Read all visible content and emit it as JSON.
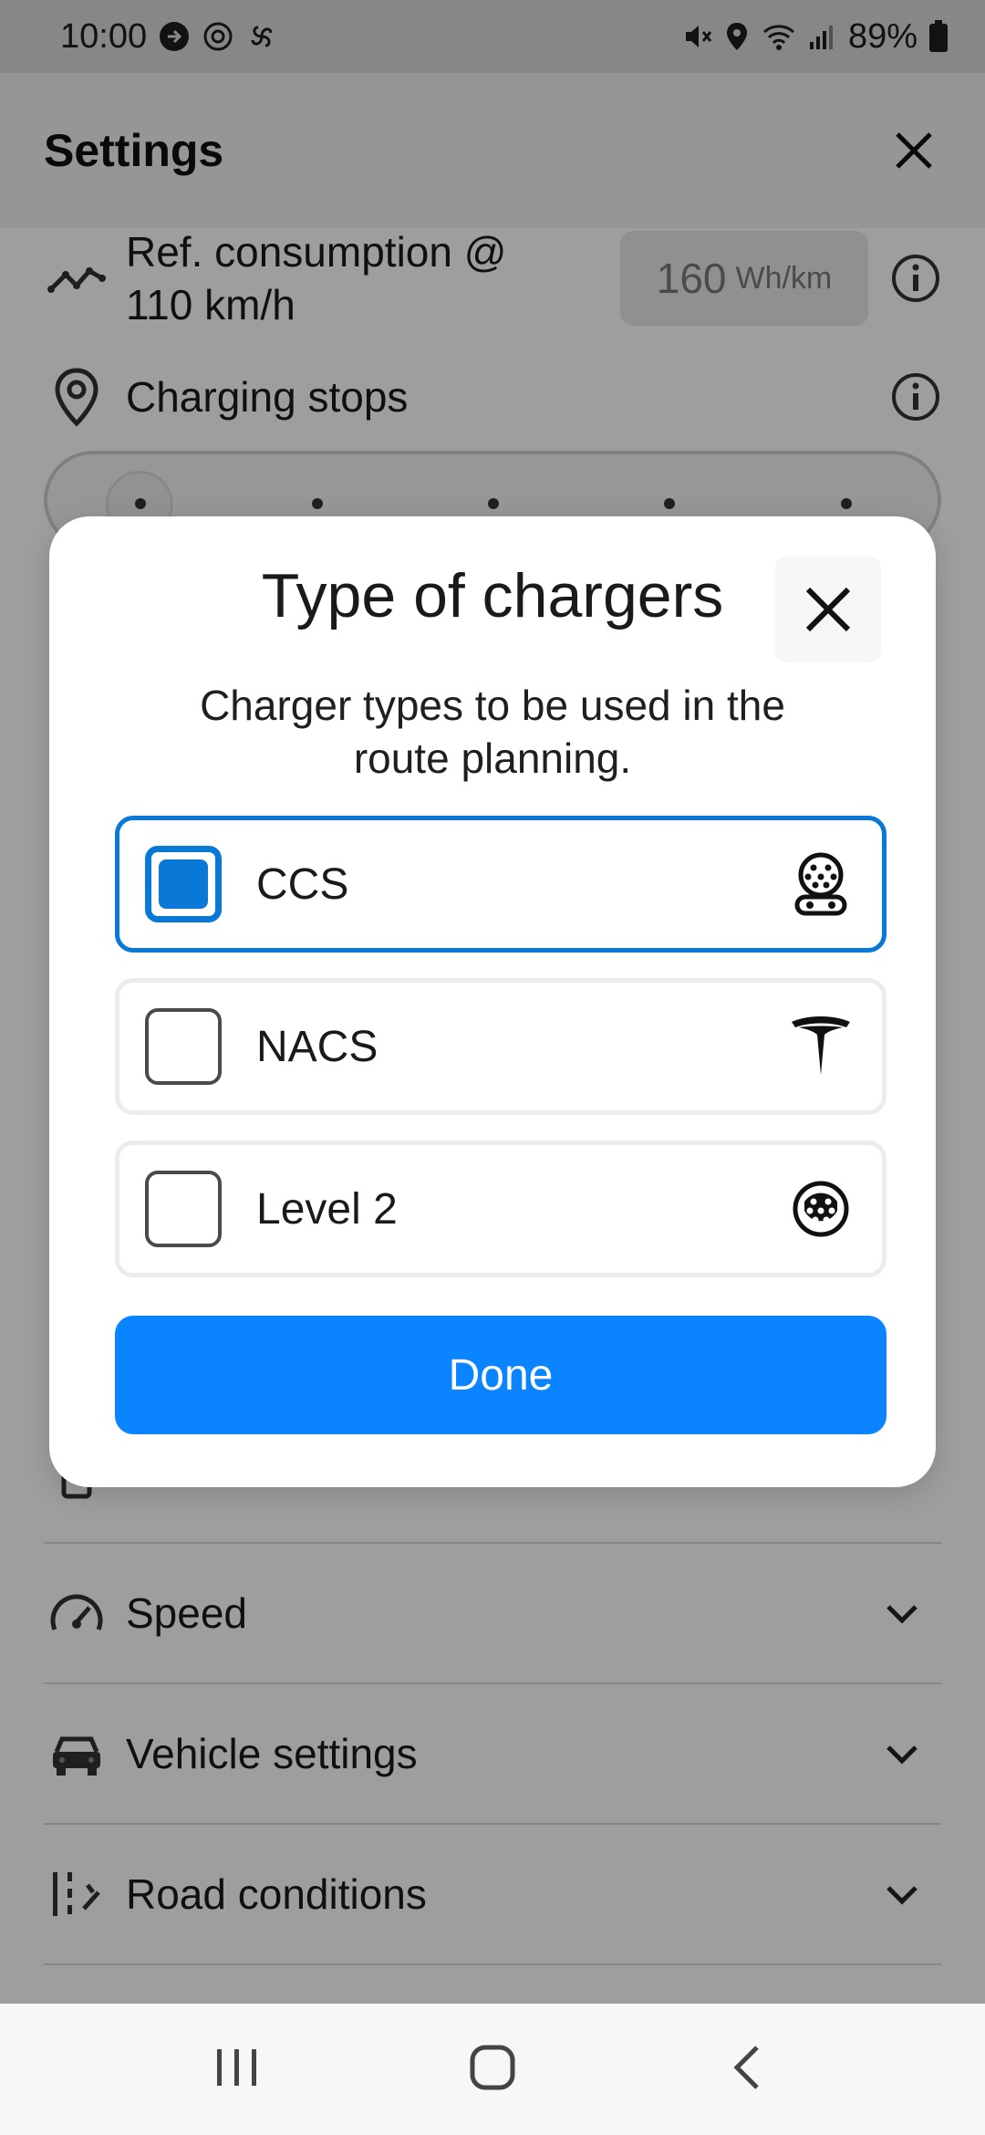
{
  "status_bar": {
    "time": "10:00",
    "battery": "89%",
    "icons_left": [
      "message-icon",
      "settings-icon",
      "pinwheel-icon"
    ],
    "icons_right": [
      "mute-icon",
      "location-icon",
      "wifi-icon",
      "signal-icon",
      "battery-icon"
    ]
  },
  "settings": {
    "title": "Settings",
    "ref_consumption": {
      "label_line1": "Ref. consumption @",
      "label_line2": "110 km/h",
      "value": "160",
      "unit": "Wh/km"
    },
    "charging_stops": {
      "label": "Charging stops"
    },
    "sections": [
      {
        "label": "Speed",
        "icon": "speedometer-icon"
      },
      {
        "label": "Vehicle settings",
        "icon": "car-icon"
      },
      {
        "label": "Road conditions",
        "icon": "road-icon"
      }
    ]
  },
  "modal": {
    "title": "Type of chargers",
    "description": "Charger types to be used in the route planning.",
    "options": [
      {
        "label": "CCS",
        "checked": true,
        "icon": "ccs-connector-icon"
      },
      {
        "label": "NACS",
        "checked": false,
        "icon": "tesla-logo-icon"
      },
      {
        "label": "Level 2",
        "checked": false,
        "icon": "type2-connector-icon"
      }
    ],
    "done_label": "Done",
    "accent_color": "#0a84ff"
  },
  "nav_bar": {
    "buttons": [
      "recents-button",
      "home-button",
      "back-button"
    ]
  }
}
